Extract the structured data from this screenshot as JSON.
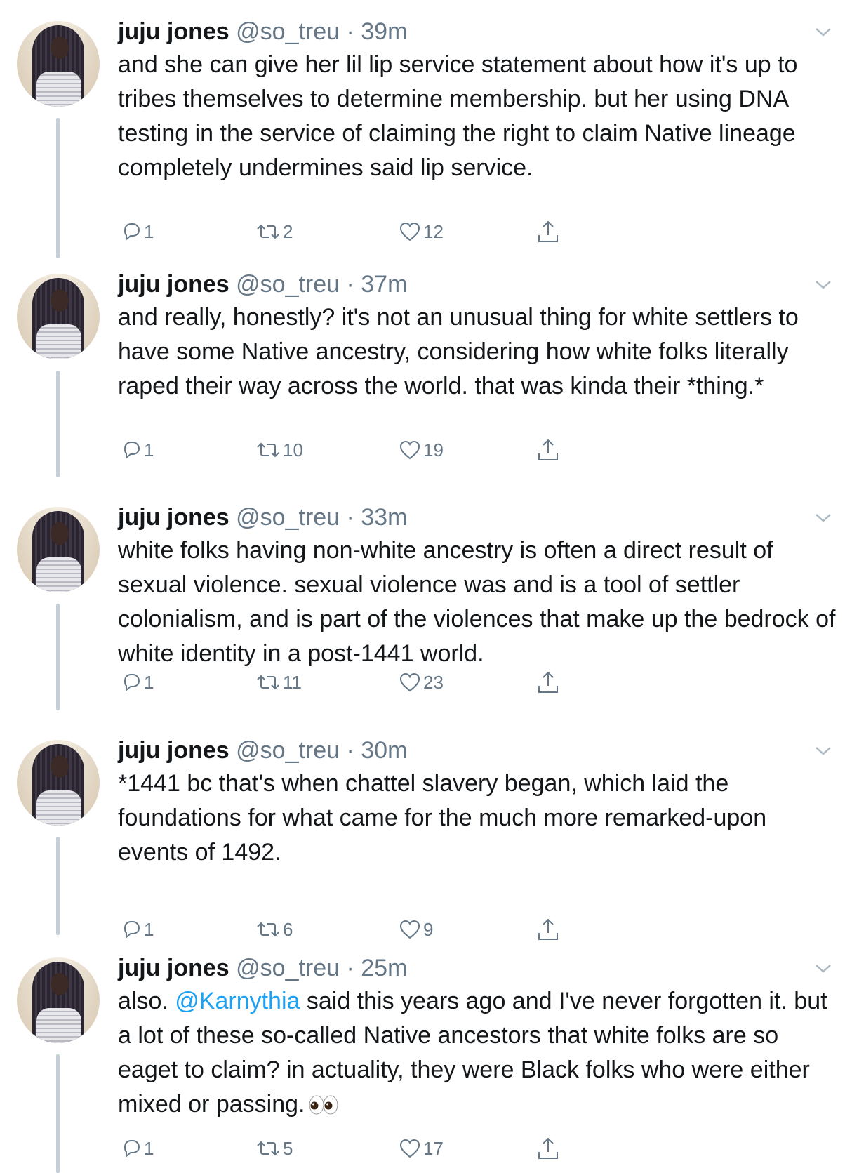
{
  "tweets": [
    {
      "display_name": "juju jones",
      "handle": "@so_treu",
      "time": " · 39m",
      "text": "and she can give her lil lip service statement about how it's up to tribes themselves to determine membership. but her using DNA testing in the service of claiming the right to claim Native lineage completely undermines said lip service.",
      "replies": "1",
      "retweets": "2",
      "likes": "12"
    },
    {
      "display_name": "juju jones",
      "handle": "@so_treu",
      "time": " · 37m",
      "text": "and really, honestly? it's not an unusual thing for white settlers to have some Native ancestry, considering how white folks literally raped their way across the world. that was kinda their *thing.*",
      "replies": "1",
      "retweets": "10",
      "likes": "19"
    },
    {
      "display_name": "juju jones",
      "handle": "@so_treu",
      "time": " · 33m",
      "text": "white folks having non-white ancestry is often a direct result of sexual violence. sexual violence was and is a tool of settler colonialism, and is part of the violences that make up the bedrock of white identity in a post-1441 world.",
      "replies": "1",
      "retweets": "11",
      "likes": "23"
    },
    {
      "display_name": "juju jones",
      "handle": "@so_treu",
      "time": " · 30m",
      "text": "*1441 bc that's when chattel slavery began, which laid the foundations for what came for the much more remarked-upon events of 1492.",
      "replies": "1",
      "retweets": "6",
      "likes": "9"
    },
    {
      "display_name": "juju jones",
      "handle": "@so_treu",
      "time": " · 25m",
      "text_before": "also. ",
      "mention": "@Karnythia",
      "text_after": " said this years ago and I've never forgotten it. but a lot of these so-called Native ancestors that white folks are so eaget to claim? in actuality, they were Black folks who were either mixed or passing.",
      "emoji": "eyes-emoji",
      "replies": "1",
      "retweets": "5",
      "likes": "17"
    }
  ],
  "icons": {
    "reply": "reply-icon",
    "retweet": "retweet-icon",
    "like": "heart-icon",
    "share": "share-icon",
    "caret": "chevron-down-icon"
  },
  "colors": {
    "text": "#14171a",
    "secondary": "#657786",
    "link": "#1da1f2",
    "thread_line": "#c4cfd6"
  }
}
